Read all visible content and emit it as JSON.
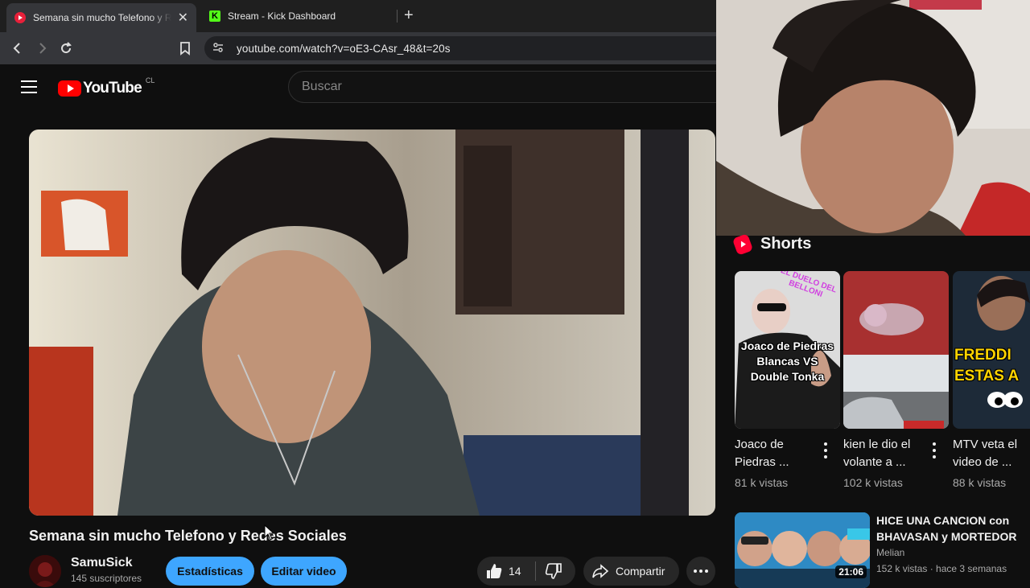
{
  "browser": {
    "tabs": [
      {
        "title": "Semana sin mucho Telefono y Redes Sociales",
        "active": true
      },
      {
        "title": "Stream - Kick Dashboard",
        "active": false
      }
    ],
    "new_tab_symbol": "+",
    "url": "youtube.com/watch?v=oE3-CAsr_48&t=20s"
  },
  "youtube": {
    "logo_text": "YouTube",
    "country_code": "CL",
    "search_placeholder": "Buscar"
  },
  "video": {
    "title": "Semana sin mucho Telefono y Redes Sociales",
    "channel_name": "SamuSick",
    "subscribers": "145 suscriptores",
    "stats_button": "Estadísticas",
    "edit_button": "Editar video",
    "likes": "14",
    "share_label": "Compartir"
  },
  "sidebar": {
    "shorts_heading": "Shorts",
    "shorts": [
      {
        "title": "Joaco de Piedras ...",
        "views": "81 k vistas",
        "thumb_text": "Joaco de Piedras Blancas VS Double Tonka",
        "thumb_banner": "EL DUELO DEL BELLONI"
      },
      {
        "title": "kien le dio el volante a ...",
        "views": "102 k vistas"
      },
      {
        "title": "MTV veta el video de ...",
        "views": "88 k vistas",
        "thumb_text": "FREDDI ESTAS A"
      }
    ],
    "recommended": {
      "title": "HICE UNA CANCION con BHAVASAN y MORTEDOR",
      "channel": "Melian",
      "meta": "152 k vistas · hace 3 semanas",
      "duration": "21:06"
    }
  },
  "colors": {
    "background": "#0f0f0f",
    "accent_blue": "#3ea6ff",
    "youtube_red": "#ff0000"
  }
}
